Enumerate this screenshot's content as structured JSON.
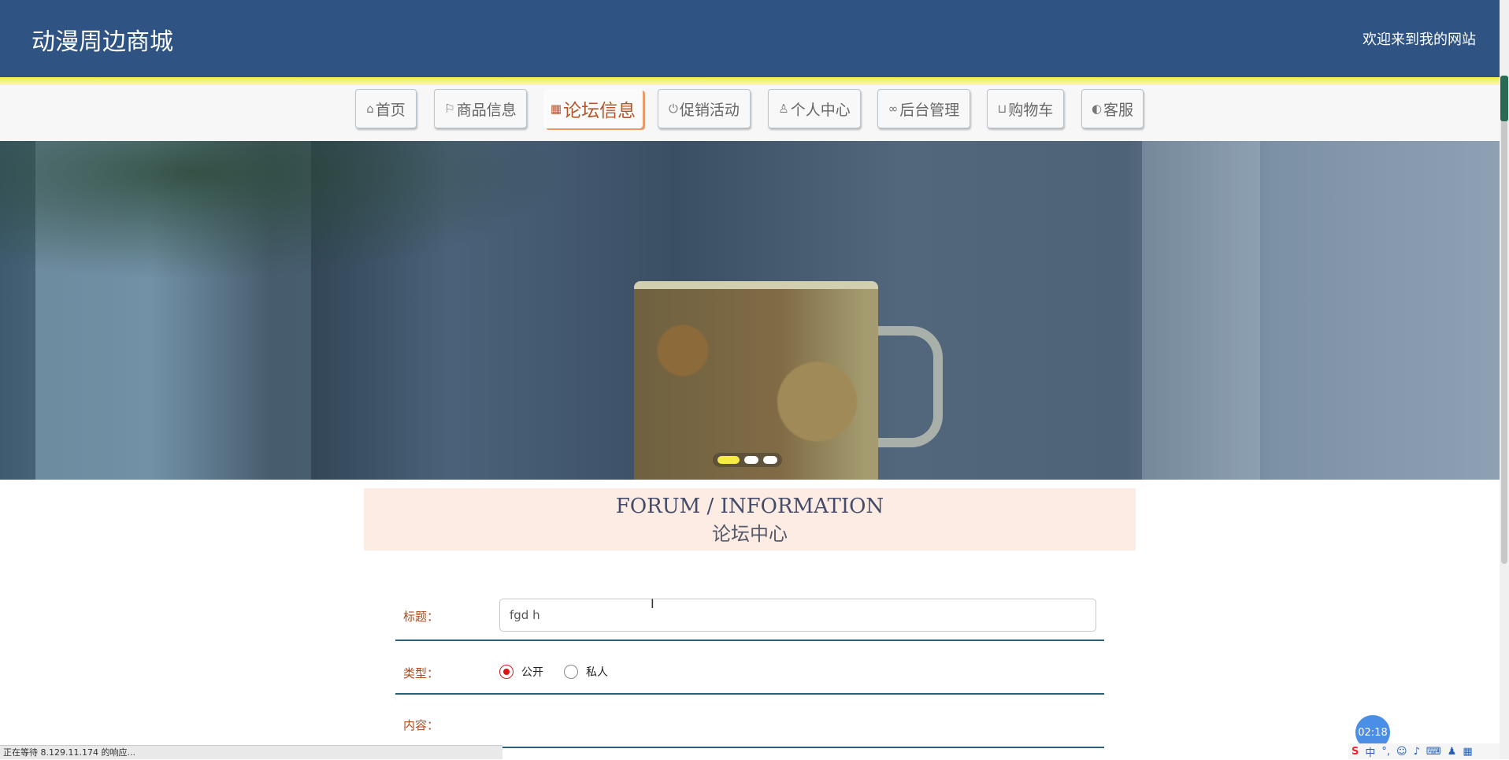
{
  "header": {
    "site_title": "动漫周边商城",
    "welcome": "欢迎来到我的网站"
  },
  "nav": {
    "items": [
      {
        "label": "首页",
        "icon": "home-icon",
        "glyph": "⌂"
      },
      {
        "label": "商品信息",
        "icon": "flag-icon",
        "glyph": "⚐"
      },
      {
        "label": "论坛信息",
        "icon": "grid-icon",
        "glyph": "▦",
        "active": true
      },
      {
        "label": "促销活动",
        "icon": "power-icon",
        "glyph": "⏻"
      },
      {
        "label": "个人中心",
        "icon": "user-icon",
        "glyph": "♙"
      },
      {
        "label": "后台管理",
        "icon": "link-icon",
        "glyph": "∞"
      },
      {
        "label": "购物车",
        "icon": "cart-icon",
        "glyph": "⊔"
      },
      {
        "label": "客服",
        "icon": "service-icon",
        "glyph": "◐"
      }
    ]
  },
  "banner": {
    "slide_count": 3,
    "active_slide": 1
  },
  "forum": {
    "title_en": "FORUM / INFORMATION",
    "title_cn": "论坛中心"
  },
  "form": {
    "title_label": "标题：",
    "title_value": "fgd h",
    "type_label": "类型：",
    "type_options": [
      "公开",
      "私人"
    ],
    "type_selected": "公开",
    "content_label": "内容："
  },
  "status_bar": {
    "text": "正在等待 8.129.11.174 的响应..."
  },
  "timer": {
    "text": "02:18"
  },
  "ime": {
    "lang": "中"
  },
  "colors": {
    "header_bg": "#2f5383",
    "accent_yellow": "#f4ee46",
    "active_nav": "#b5562a"
  }
}
